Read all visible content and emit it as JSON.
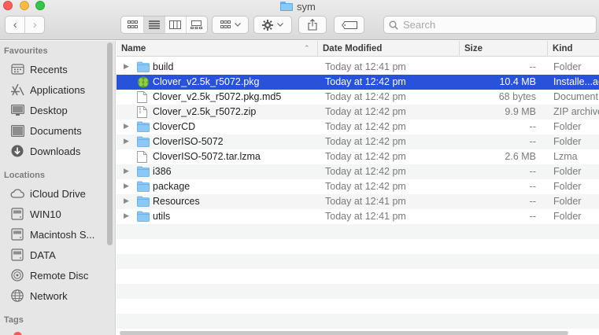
{
  "window": {
    "title": "sym"
  },
  "toolbar": {
    "back_glyph": "‹",
    "forward_glyph": "›",
    "search_placeholder": "Search"
  },
  "sidebar": {
    "favourites_heading": "Favourites",
    "favourites": [
      {
        "label": "Recents",
        "icon": "clock-icon"
      },
      {
        "label": "Applications",
        "icon": "applications-icon"
      },
      {
        "label": "Desktop",
        "icon": "desktop-icon"
      },
      {
        "label": "Documents",
        "icon": "document-icon"
      },
      {
        "label": "Downloads",
        "icon": "download-icon"
      }
    ],
    "locations_heading": "Locations",
    "locations": [
      {
        "label": "iCloud Drive",
        "icon": "cloud-icon"
      },
      {
        "label": "WIN10",
        "icon": "drive-icon"
      },
      {
        "label": "Macintosh S...",
        "icon": "drive-icon"
      },
      {
        "label": "DATA",
        "icon": "drive-icon"
      },
      {
        "label": "Remote Disc",
        "icon": "disc-icon"
      },
      {
        "label": "Network",
        "icon": "network-icon"
      }
    ],
    "tags_heading": "Tags"
  },
  "columns": {
    "name": "Name",
    "date": "Date Modified",
    "size": "Size",
    "kind": "Kind"
  },
  "files": [
    {
      "name": "build",
      "date": "Today at 12:41 pm",
      "size": "--",
      "kind": "Folder",
      "type": "folder"
    },
    {
      "name": "Clover_v2.5k_r5072.pkg",
      "date": "Today at 12:42 pm",
      "size": "10.4 MB",
      "kind": "Installe...ackage",
      "type": "pkg",
      "selected": true
    },
    {
      "name": "Clover_v2.5k_r5072.pkg.md5",
      "date": "Today at 12:42 pm",
      "size": "68 bytes",
      "kind": "Document",
      "type": "doc"
    },
    {
      "name": "Clover_v2.5k_r5072.zip",
      "date": "Today at 12:42 pm",
      "size": "9.9 MB",
      "kind": "ZIP archive",
      "type": "zip"
    },
    {
      "name": "CloverCD",
      "date": "Today at 12:42 pm",
      "size": "--",
      "kind": "Folder",
      "type": "folder"
    },
    {
      "name": "CloverISO-5072",
      "date": "Today at 12:42 pm",
      "size": "--",
      "kind": "Folder",
      "type": "folder"
    },
    {
      "name": "CloverISO-5072.tar.lzma",
      "date": "Today at 12:42 pm",
      "size": "2.6 MB",
      "kind": "Lzma",
      "type": "doc"
    },
    {
      "name": "i386",
      "date": "Today at 12:42 pm",
      "size": "--",
      "kind": "Folder",
      "type": "folder"
    },
    {
      "name": "package",
      "date": "Today at 12:42 pm",
      "size": "--",
      "kind": "Folder",
      "type": "folder"
    },
    {
      "name": "Resources",
      "date": "Today at 12:41 pm",
      "size": "--",
      "kind": "Folder",
      "type": "folder"
    },
    {
      "name": "utils",
      "date": "Today at 12:41 pm",
      "size": "--",
      "kind": "Folder",
      "type": "folder"
    }
  ],
  "colors": {
    "selection": "#2852d9",
    "folder": "#8cc8f5",
    "sidebar": "#e7e6e6"
  }
}
